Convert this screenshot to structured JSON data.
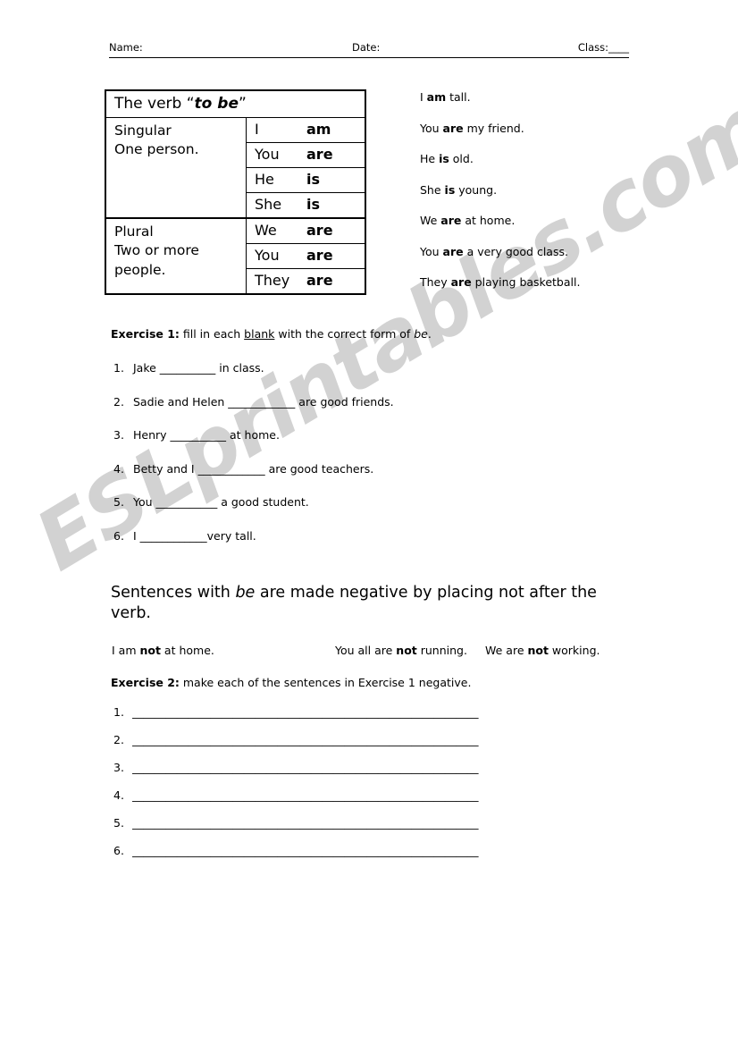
{
  "header": {
    "name_label": "Name:",
    "date_label": "Date:",
    "class_label": "Class:____"
  },
  "verb_table": {
    "title_prefix": "The verb “",
    "title_italic": "to be",
    "title_suffix": "”",
    "groups": [
      {
        "name": "Singular",
        "description": "One person.",
        "rows": [
          {
            "pronoun": "I",
            "form": "am"
          },
          {
            "pronoun": "You",
            "form": "are"
          },
          {
            "pronoun": "He",
            "form": "is"
          },
          {
            "pronoun": "She",
            "form": "is"
          }
        ]
      },
      {
        "name": "Plural",
        "description": "Two or more people.",
        "rows": [
          {
            "pronoun": "We",
            "form": "are"
          },
          {
            "pronoun": "You",
            "form": "are"
          },
          {
            "pronoun": "They",
            "form": "are"
          }
        ]
      }
    ]
  },
  "examples": [
    {
      "before": "I ",
      "verb": "am",
      "after": " tall."
    },
    {
      "before": "You ",
      "verb": "are",
      "after": " my friend."
    },
    {
      "before": "He ",
      "verb": "is",
      "after": " old."
    },
    {
      "before": "She ",
      "verb": "is",
      "after": " young."
    },
    {
      "before": "We ",
      "verb": "are",
      "after": " at home."
    },
    {
      "before": "You ",
      "verb": "are",
      "after": " a very good class."
    },
    {
      "before": "They ",
      "verb": "are",
      "after": " playing basketball."
    }
  ],
  "exercise1": {
    "label": "Exercise 1:",
    "instruction_before": " fill in each ",
    "instruction_underlined": "blank",
    "instruction_middle": " with the correct form of ",
    "instruction_italic": "be",
    "instruction_after": ".",
    "items": [
      {
        "num": "1.",
        "text": "Jake __________ in class."
      },
      {
        "num": "2.",
        "text": "Sadie and Helen ____________ are good friends."
      },
      {
        "num": "3.",
        "text": "Henry __________ at home."
      },
      {
        "num": "4.",
        "text": "Betty and I ____________ are good teachers."
      },
      {
        "num": "5.",
        "text": "You ___________ a good student."
      },
      {
        "num": "6.",
        "text": "I ____________very tall."
      }
    ]
  },
  "negative_section": {
    "heading_before": "Sentences with ",
    "heading_italic": "be",
    "heading_after": " are made negative by placing not after the verb.",
    "examples": [
      {
        "before": "I am ",
        "neg": "not",
        "after": " at home."
      },
      {
        "before": "You all are ",
        "neg": "not",
        "after": " running."
      },
      {
        "before": "We are ",
        "neg": "not",
        "after": " working."
      }
    ]
  },
  "exercise2": {
    "label": "Exercise 2:",
    "instruction": " make each of the sentences in Exercise 1 negative.",
    "items": [
      {
        "num": "1.",
        "line": "______________________________________________________________"
      },
      {
        "num": "2.",
        "line": "______________________________________________________________"
      },
      {
        "num": "3.",
        "line": "______________________________________________________________"
      },
      {
        "num": "4.",
        "line": "______________________________________________________________"
      },
      {
        "num": "5.",
        "line": "______________________________________________________________"
      },
      {
        "num": "6.",
        "line": "______________________________________________________________"
      }
    ]
  },
  "watermark": {
    "text": "ESLprintables.com",
    "color": "#d2d2d2"
  }
}
